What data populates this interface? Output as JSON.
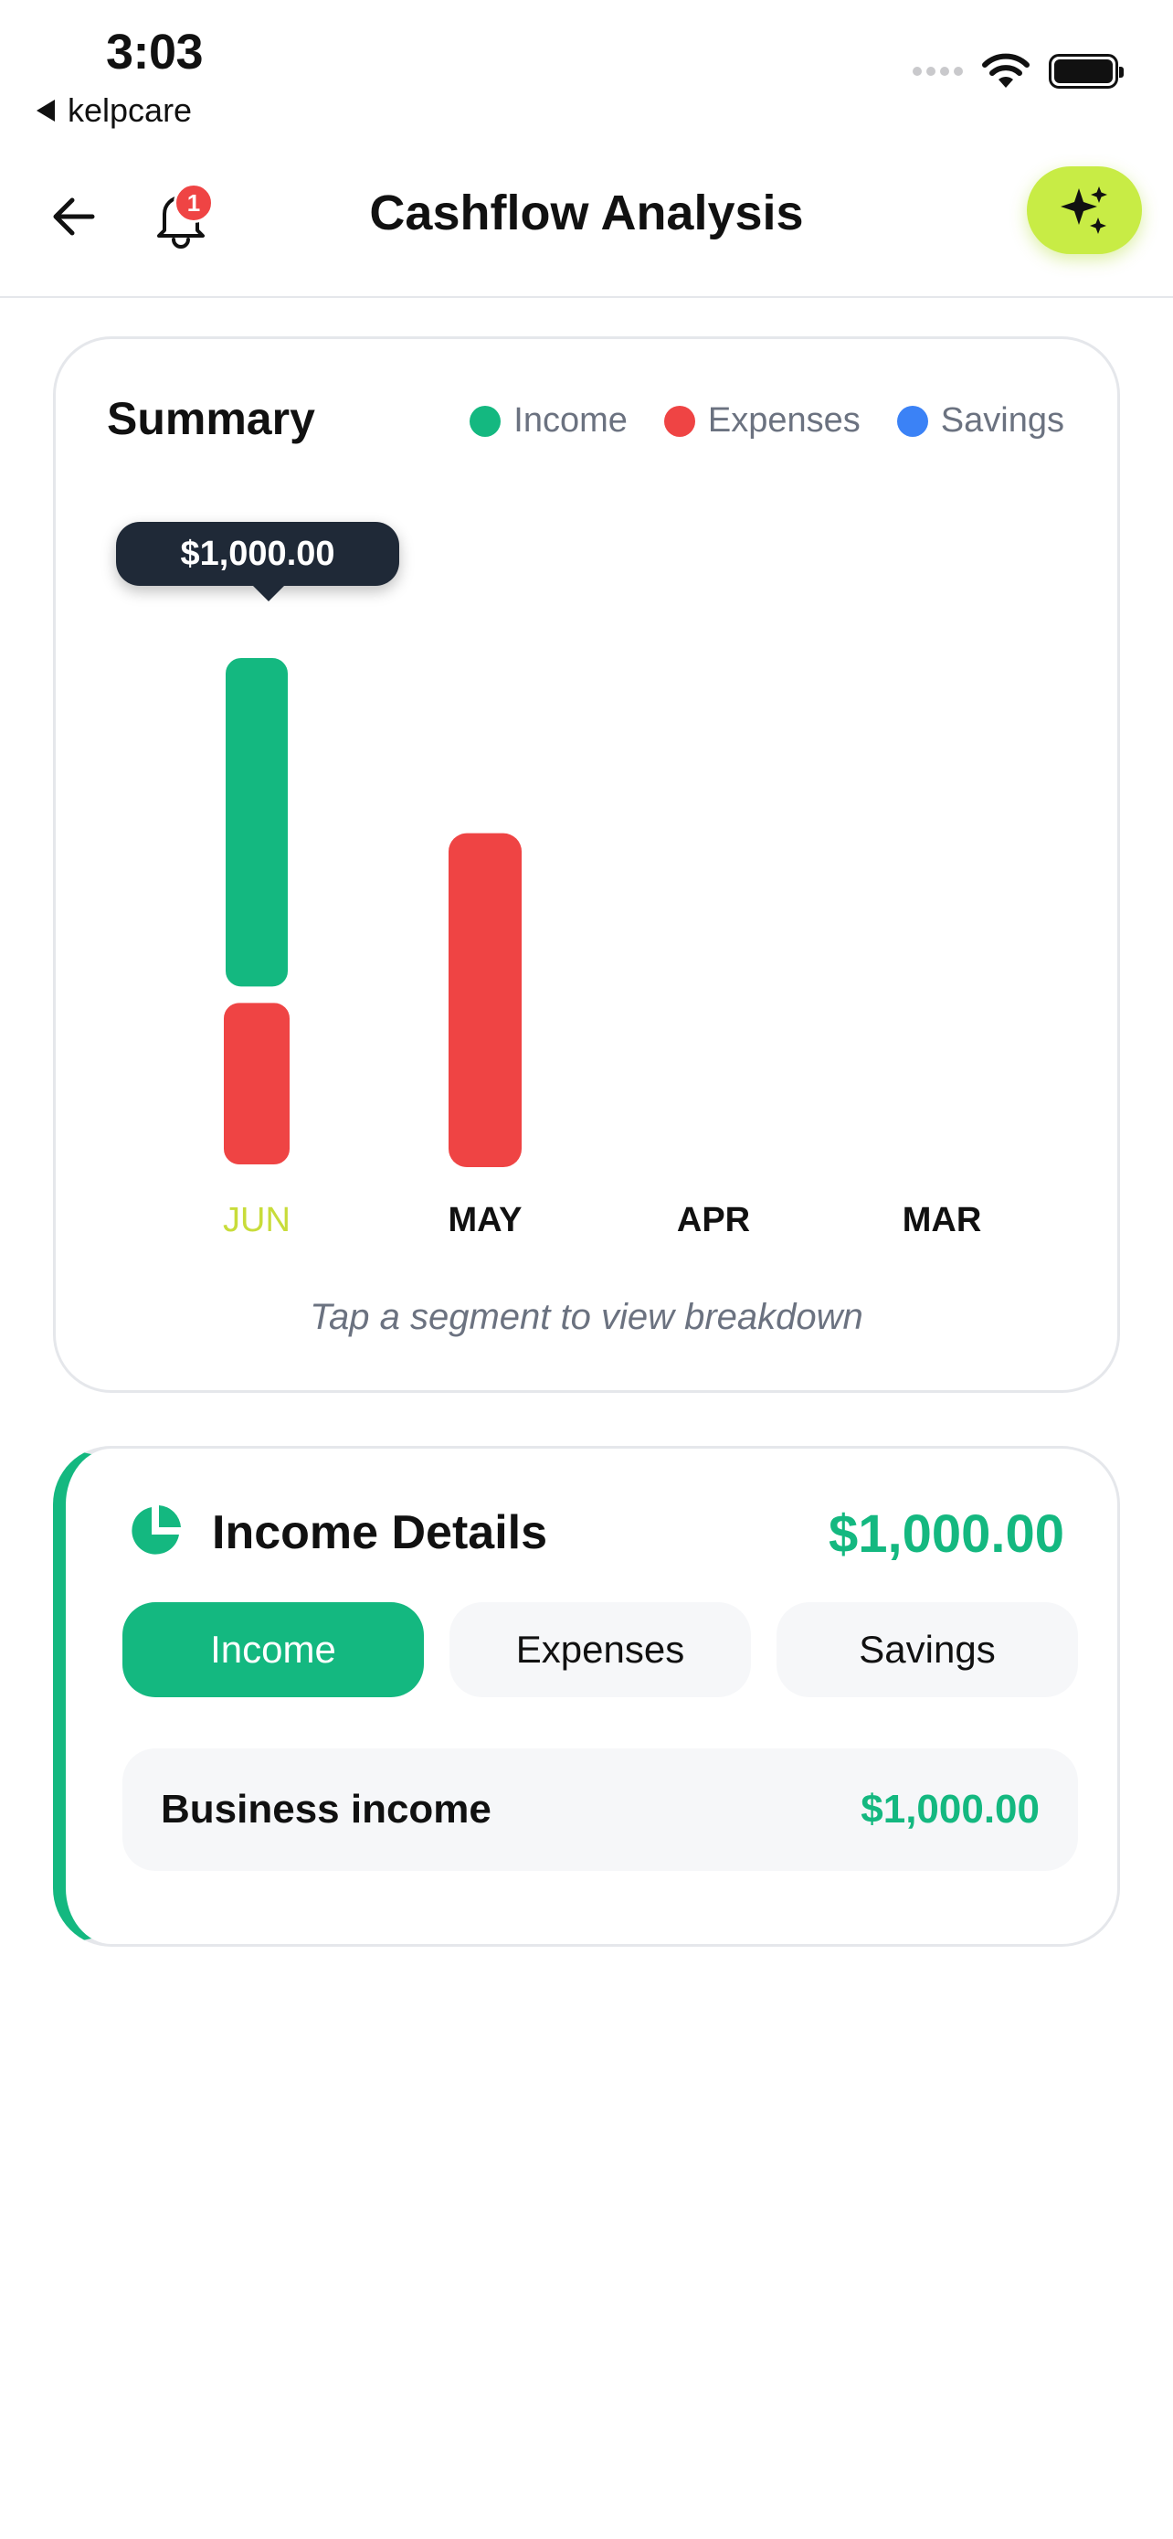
{
  "status_bar": {
    "time": "3:03",
    "back_app": "kelpcare"
  },
  "header": {
    "title": "Cashflow Analysis",
    "notification_count": "1",
    "icons": [
      "back-arrow-icon",
      "bell-icon",
      "sparkles-icon"
    ]
  },
  "summary": {
    "title": "Summary",
    "legend": [
      {
        "label": "Income",
        "color": "#14b880"
      },
      {
        "label": "Expenses",
        "color": "#ef4444"
      },
      {
        "label": "Savings",
        "color": "#3b82f6"
      }
    ],
    "tooltip": "$1,000.00",
    "hint": "Tap a segment to view breakdown",
    "selected_color": "#c8dc3a"
  },
  "chart_data": {
    "type": "bar",
    "stacked": true,
    "categories": [
      "JUN",
      "MAY",
      "APR",
      "MAR"
    ],
    "selected_category": "JUN",
    "series": [
      {
        "name": "Income",
        "color": "#14b880",
        "values": [
          1000,
          0,
          0,
          0
        ]
      },
      {
        "name": "Expenses",
        "color": "#ef4444",
        "values": [
          500,
          1000,
          0,
          0
        ]
      },
      {
        "name": "Savings",
        "color": "#3b82f6",
        "values": [
          0,
          0,
          0,
          0
        ]
      }
    ]
  },
  "details": {
    "title": "Income Details",
    "total": "$1,000.00",
    "tabs": [
      "Income",
      "Expenses",
      "Savings"
    ],
    "active_tab": "Income",
    "accent_color": "#14b880",
    "rows": [
      {
        "name": "Business income",
        "value": "$1,000.00"
      }
    ]
  }
}
